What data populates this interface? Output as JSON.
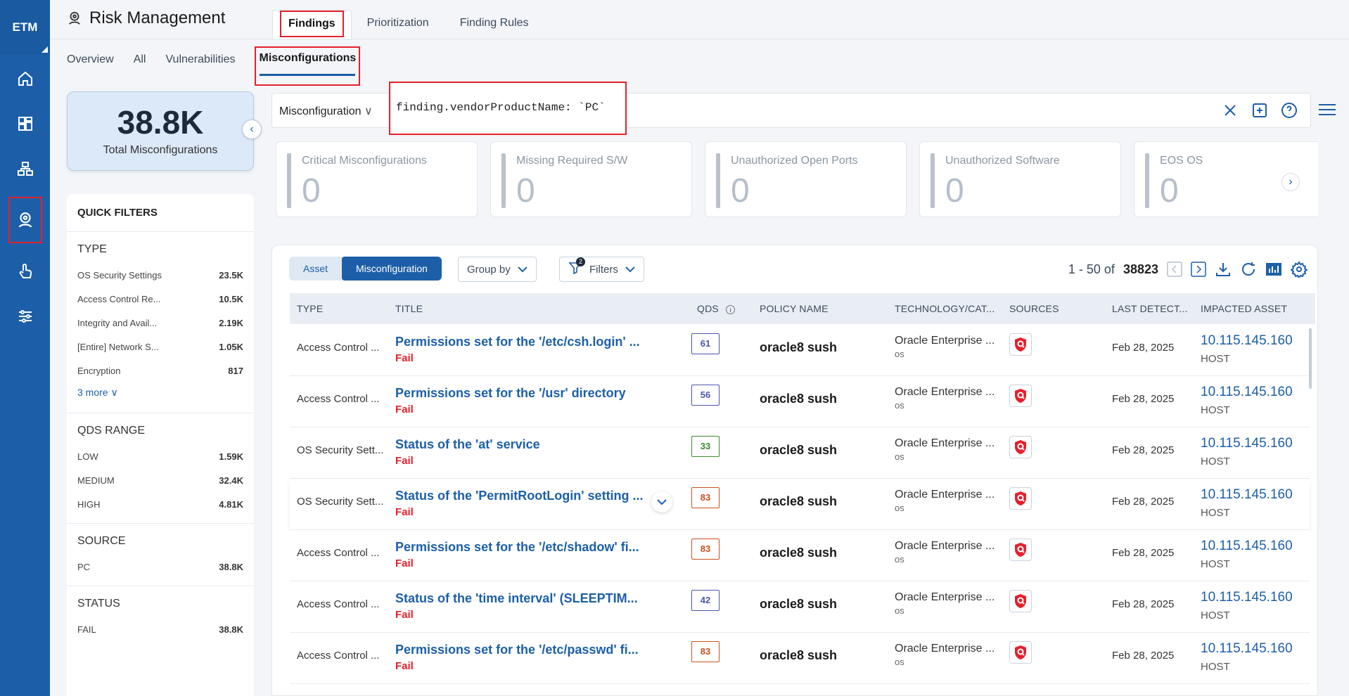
{
  "rail": {
    "brand": "ETM",
    "items": [
      {
        "name": "home-icon"
      },
      {
        "name": "dashboard-icon"
      },
      {
        "name": "assets-icon"
      },
      {
        "name": "risk-icon",
        "active": true
      },
      {
        "name": "response-icon"
      },
      {
        "name": "settings-sliders-icon"
      }
    ]
  },
  "header": {
    "title": "Risk Management",
    "tabs": [
      {
        "label": "Findings",
        "active": true
      },
      {
        "label": "Prioritization"
      },
      {
        "label": "Finding Rules"
      }
    ]
  },
  "subtabs": [
    {
      "label": "Overview"
    },
    {
      "label": "All"
    },
    {
      "label": "Vulnerabilities"
    },
    {
      "label": "Misconfigurations",
      "active": true
    }
  ],
  "summary": {
    "value": "38.8K",
    "label": "Total Misconfigurations"
  },
  "quick_filters": {
    "title": "QUICK FILTERS",
    "type": {
      "heading": "TYPE",
      "rows": [
        {
          "label": "OS Security Settings",
          "count": "23.5K"
        },
        {
          "label": "Access Control Re...",
          "count": "10.5K"
        },
        {
          "label": "Integrity and Avail...",
          "count": "2.19K"
        },
        {
          "label": "[Entire] Network S...",
          "count": "1.05K"
        },
        {
          "label": "Encryption",
          "count": "817"
        }
      ],
      "more": "3 more"
    },
    "qds": {
      "heading": "QDS RANGE",
      "rows": [
        {
          "label": "LOW",
          "count": "1.59K"
        },
        {
          "label": "MEDIUM",
          "count": "32.4K"
        },
        {
          "label": "HIGH",
          "count": "4.81K"
        }
      ]
    },
    "source": {
      "heading": "SOURCE",
      "rows": [
        {
          "label": "PC",
          "count": "38.8K"
        }
      ]
    },
    "status": {
      "heading": "STATUS",
      "rows": [
        {
          "label": "FAIL",
          "count": "38.8K"
        }
      ]
    }
  },
  "search": {
    "type_select": "Misconfiguration",
    "query": "finding.vendorProductName: `PC`"
  },
  "kpis": [
    {
      "label": "Critical Misconfigurations",
      "value": "0"
    },
    {
      "label": "Missing Required S/W",
      "value": "0"
    },
    {
      "label": "Unauthorized Open Ports",
      "value": "0"
    },
    {
      "label": "Unauthorized Software",
      "value": "0"
    },
    {
      "label": "EOS OS",
      "value": "0"
    }
  ],
  "toolbar": {
    "seg_asset": "Asset",
    "seg_misconfig": "Misconfiguration",
    "group_by": "Group by",
    "filters": "Filters",
    "filter_count": "2",
    "pager_range": "1 - 50 of",
    "pager_total": "38823"
  },
  "table": {
    "headers": {
      "type": "TYPE",
      "title": "TITLE",
      "qds": "QDS",
      "policy": "POLICY NAME",
      "tech": "TECHNOLOGY/CAT...",
      "sources": "SOURCES",
      "last": "LAST DETECT...",
      "asset": "IMPACTED ASSET"
    },
    "rows": [
      {
        "type": "Access Control ...",
        "title": "Permissions set for the '/etc/csh.login' ...",
        "status": "Fail",
        "qds": "61",
        "qds_color": "#4a57a8",
        "policy": "oracle8 sush",
        "tech": "Oracle Enterprise ...",
        "tech_sub": "os",
        "date": "Feb 28, 2025",
        "ip": "10.115.145.160",
        "asset_type": "HOST"
      },
      {
        "type": "Access Control ...",
        "title": "Permissions set for the '/usr' directory",
        "status": "Fail",
        "qds": "56",
        "qds_color": "#4a57a8",
        "policy": "oracle8 sush",
        "tech": "Oracle Enterprise ...",
        "tech_sub": "os",
        "date": "Feb 28, 2025",
        "ip": "10.115.145.160",
        "asset_type": "HOST"
      },
      {
        "type": "OS Security Sett...",
        "title": "Status of the 'at' service",
        "status": "Fail",
        "qds": "33",
        "qds_color": "#3c8a2e",
        "policy": "oracle8 sush",
        "tech": "Oracle Enterprise ...",
        "tech_sub": "os",
        "date": "Feb 28, 2025",
        "ip": "10.115.145.160",
        "asset_type": "HOST"
      },
      {
        "type": "OS Security Sett...",
        "title": "Status of the 'PermitRootLogin' setting ...",
        "status": "Fail",
        "qds": "83",
        "qds_color": "#c9501c",
        "policy": "oracle8 sush",
        "tech": "Oracle Enterprise ...",
        "tech_sub": "os",
        "date": "Feb 28, 2025",
        "ip": "10.115.145.160",
        "asset_type": "HOST"
      },
      {
        "type": "Access Control ...",
        "title": "Permissions set for the '/etc/shadow' fi...",
        "status": "Fail",
        "qds": "83",
        "qds_color": "#c9501c",
        "policy": "oracle8 sush",
        "tech": "Oracle Enterprise ...",
        "tech_sub": "os",
        "date": "Feb 28, 2025",
        "ip": "10.115.145.160",
        "asset_type": "HOST"
      },
      {
        "type": "Access Control ...",
        "title": "Status of the 'time interval' (SLEEPTIM...",
        "status": "Fail",
        "qds": "42",
        "qds_color": "#4a57a8",
        "policy": "oracle8 sush",
        "tech": "Oracle Enterprise ...",
        "tech_sub": "os",
        "date": "Feb 28, 2025",
        "ip": "10.115.145.160",
        "asset_type": "HOST"
      },
      {
        "type": "Access Control ...",
        "title": "Permissions set for the '/etc/passwd' fi...",
        "status": "Fail",
        "qds": "83",
        "qds_color": "#c9501c",
        "policy": "oracle8 sush",
        "tech": "Oracle Enterprise ...",
        "tech_sub": "os",
        "date": "Feb 28, 2025",
        "ip": "10.115.145.160",
        "asset_type": "HOST"
      }
    ]
  },
  "colors": {
    "brand": "#1c5fa8",
    "highlight": "#e5202b",
    "fail": "#e5202b"
  }
}
